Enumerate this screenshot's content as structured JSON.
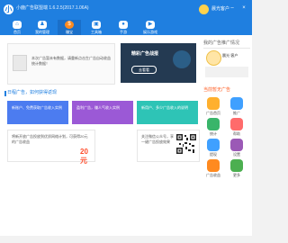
{
  "app": {
    "title": "小鹿广告联盟端 1.6.2.5(2017.1.06A)",
    "user": "晨光客户"
  },
  "nav": [
    {
      "label": "首页",
      "icon": "home-icon"
    },
    {
      "label": "我的管理",
      "icon": "user-icon"
    },
    {
      "label": "赚宝",
      "icon": "coin-icon"
    },
    {
      "label": "工具箱",
      "icon": "toolbox-icon"
    },
    {
      "label": "手游",
      "icon": "game-icon"
    },
    {
      "label": "娱乐游戏",
      "icon": "play-icon"
    }
  ],
  "notice": {
    "text": "本次广告暂未有数据，请重新点击生广告自动收益统计数据！"
  },
  "promo_card": {
    "title": "精彩广告战报",
    "button": "去看看"
  },
  "right": {
    "header": "我的广告推广情况",
    "name": "晨光·客户",
    "current": "当前暂无广告"
  },
  "section": {
    "title": "日程广告，如何获得返现"
  },
  "tiles": [
    {
      "text": "新账户、免费获取广告收入实例"
    },
    {
      "text": "盈利广告，赚人气收入实例"
    },
    {
      "text": "新用户、多少广告收入的说明"
    }
  ],
  "promo": {
    "text": "将新开放广告投放到优质网络计划，可获得20元的广告收益",
    "num": "20元"
  },
  "qr": {
    "text": "关注微信公众号，享一键广告投放效果"
  },
  "quick": [
    {
      "label": "广告首页",
      "color": "#ffb02e"
    },
    {
      "label": "推广",
      "color": "#3fa0ff"
    },
    {
      "label": "统计",
      "color": "#39b56a"
    },
    {
      "label": "帮助",
      "color": "#ff6b6b"
    },
    {
      "label": "提现",
      "color": "#3fa0ff"
    },
    {
      "label": "设置",
      "color": "#9b59b6"
    },
    {
      "label": "广告收益",
      "color": "#ff8a1f"
    },
    {
      "label": "更多",
      "color": "#4caf50"
    }
  ]
}
